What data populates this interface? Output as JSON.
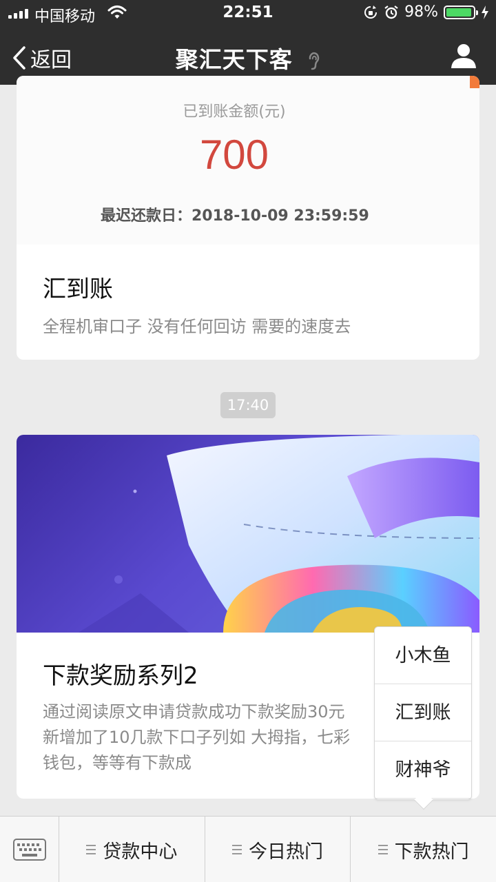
{
  "status_bar": {
    "carrier": "中国移动",
    "time": "22:51",
    "battery": "98%"
  },
  "nav": {
    "back_label": "返回",
    "title": "聚汇天下客"
  },
  "card1": {
    "screenshot": {
      "label": "已到账金额(元)",
      "amount": "700",
      "due": "最迟还款日：2018-10-09 23:59:59"
    },
    "title": "汇到账",
    "description": "全程机审口子 没有任何回访 需要的速度去"
  },
  "timestamp": "17:40",
  "card2": {
    "title": "下款奖励系列2",
    "description_lines": [
      "通过阅读原文申请贷款成功下款奖励30元",
      "新增加了10几款下口子列如 大拇指，七彩",
      "钱包，等等有下款成"
    ]
  },
  "popup_menu": {
    "items": [
      "小木鱼",
      "汇到账",
      "财神爷"
    ]
  },
  "bottom_menu": {
    "items": [
      "贷款中心",
      "今日热门",
      "下款热门"
    ]
  }
}
